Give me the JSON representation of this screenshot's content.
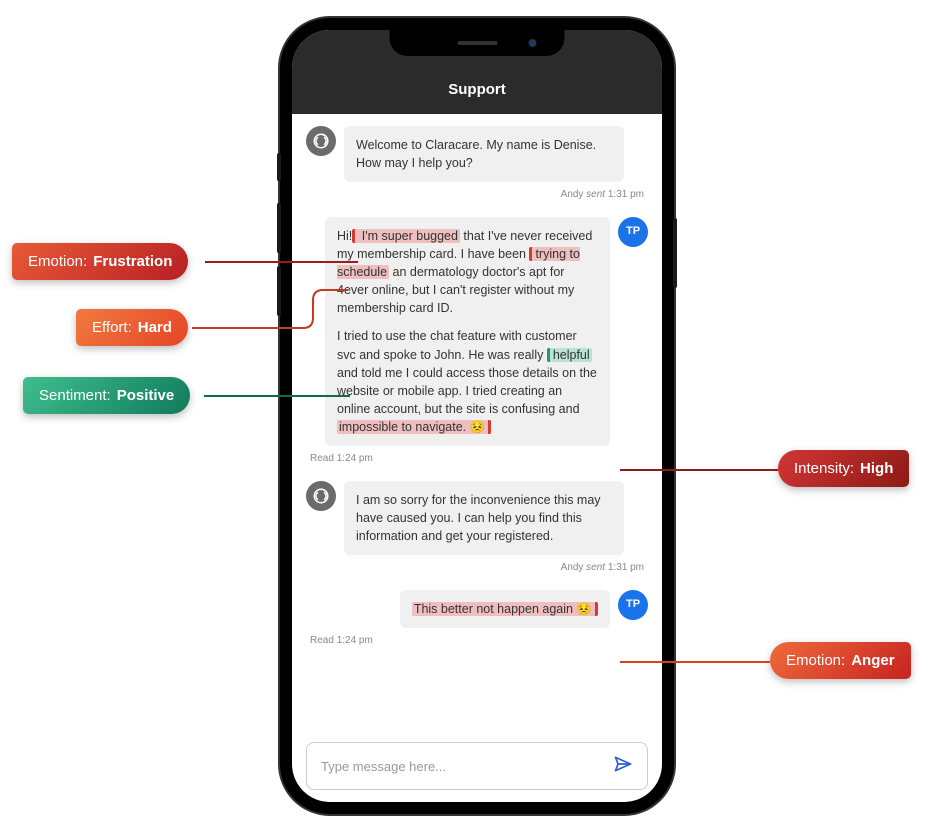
{
  "header": {
    "title": "Support"
  },
  "messages": {
    "welcome": {
      "text": "Welcome to Claracare. My name is Denise. How may I help you?",
      "meta_name": "Andy",
      "meta_action": "sent",
      "meta_time": "1:31 pm"
    },
    "customer": {
      "initials": "TP",
      "p1_pre": "Hi!",
      "p1_hl1": " I'm super bugged",
      "p1_mid1": " that I've never received my membership card. I have been ",
      "p1_hl2": "trying to schedule",
      "p1_mid2": " an dermatology doctor's apt for 4ever online, but I can't register without my membership card ID.",
      "p2_pre": "I tried to use the chat feature with customer svc and spoke to John. He was really ",
      "p2_hl1": "helpful",
      "p2_mid1": " and told me I could access those details on the website or mobile app. I tried creating an online account,  but the site is confusing and ",
      "p2_hl2": "impossible to navigate. 😣",
      "read_label": "Read",
      "read_time": "1:24 pm"
    },
    "agent_reply": {
      "text": "I am so sorry for the inconvenience this may have caused you. I can help you find this information and get your registered.",
      "meta_name": "Andy",
      "meta_action": "sent",
      "meta_time": "1:31 pm"
    },
    "customer2": {
      "text": "This better not happen again 😣",
      "read_label": "Read",
      "read_time": "1:24 pm",
      "initials": "TP"
    }
  },
  "compose": {
    "placeholder": "Type message here..."
  },
  "annotations": {
    "frustration": {
      "label": "Emotion:",
      "value": "Frustration"
    },
    "effort": {
      "label": "Effort:",
      "value": "Hard"
    },
    "sentiment": {
      "label": "Sentiment:",
      "value": "Positive"
    },
    "intensity": {
      "label": "Intensity:",
      "value": "High"
    },
    "anger": {
      "label": "Emotion:",
      "value": "Anger"
    }
  }
}
